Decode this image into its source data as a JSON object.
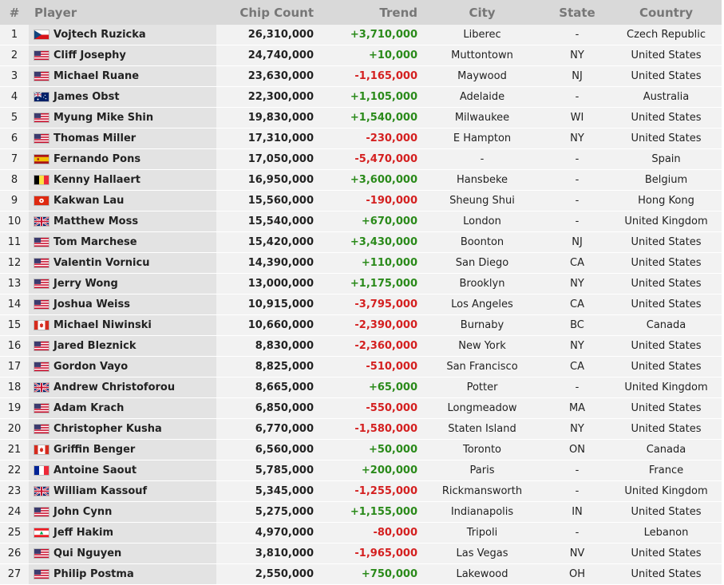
{
  "headers": {
    "num": "#",
    "player": "Player",
    "chips": "Chip Count",
    "trend": "Trend",
    "city": "City",
    "state": "State",
    "country": "Country"
  },
  "rows": [
    {
      "num": "1",
      "name": "Vojtech Ruzicka",
      "flag": "cz",
      "chips": "26,310,000",
      "trend": "+3,710,000",
      "dir": "up",
      "city": "Liberec",
      "state": "-",
      "country": "Czech Republic"
    },
    {
      "num": "2",
      "name": "Cliff Josephy",
      "flag": "us",
      "chips": "24,740,000",
      "trend": "+10,000",
      "dir": "up",
      "city": "Muttontown",
      "state": "NY",
      "country": "United States"
    },
    {
      "num": "3",
      "name": "Michael Ruane",
      "flag": "us",
      "chips": "23,630,000",
      "trend": "-1,165,000",
      "dir": "down",
      "city": "Maywood",
      "state": "NJ",
      "country": "United States"
    },
    {
      "num": "4",
      "name": "James Obst",
      "flag": "au",
      "chips": "22,300,000",
      "trend": "+1,105,000",
      "dir": "up",
      "city": "Adelaide",
      "state": "-",
      "country": "Australia"
    },
    {
      "num": "5",
      "name": "Myung Mike Shin",
      "flag": "us",
      "chips": "19,830,000",
      "trend": "+1,540,000",
      "dir": "up",
      "city": "Milwaukee",
      "state": "WI",
      "country": "United States"
    },
    {
      "num": "6",
      "name": "Thomas Miller",
      "flag": "us",
      "chips": "17,310,000",
      "trend": "-230,000",
      "dir": "down",
      "city": "E Hampton",
      "state": "NY",
      "country": "United States"
    },
    {
      "num": "7",
      "name": "Fernando Pons",
      "flag": "es",
      "chips": "17,050,000",
      "trend": "-5,470,000",
      "dir": "down",
      "city": "-",
      "state": "-",
      "country": "Spain"
    },
    {
      "num": "8",
      "name": "Kenny Hallaert",
      "flag": "be",
      "chips": "16,950,000",
      "trend": "+3,600,000",
      "dir": "up",
      "city": "Hansbeke",
      "state": "-",
      "country": "Belgium"
    },
    {
      "num": "9",
      "name": "Kakwan Lau",
      "flag": "hk",
      "chips": "15,560,000",
      "trend": "-190,000",
      "dir": "down",
      "city": "Sheung Shui",
      "state": "-",
      "country": "Hong Kong"
    },
    {
      "num": "10",
      "name": "Matthew Moss",
      "flag": "gb",
      "chips": "15,540,000",
      "trend": "+670,000",
      "dir": "up",
      "city": "London",
      "state": "-",
      "country": "United Kingdom"
    },
    {
      "num": "11",
      "name": "Tom Marchese",
      "flag": "us",
      "chips": "15,420,000",
      "trend": "+3,430,000",
      "dir": "up",
      "city": "Boonton",
      "state": "NJ",
      "country": "United States"
    },
    {
      "num": "12",
      "name": "Valentin Vornicu",
      "flag": "us",
      "chips": "14,390,000",
      "trend": "+110,000",
      "dir": "up",
      "city": "San Diego",
      "state": "CA",
      "country": "United States"
    },
    {
      "num": "13",
      "name": "Jerry Wong",
      "flag": "us",
      "chips": "13,000,000",
      "trend": "+1,175,000",
      "dir": "up",
      "city": "Brooklyn",
      "state": "NY",
      "country": "United States"
    },
    {
      "num": "14",
      "name": "Joshua Weiss",
      "flag": "us",
      "chips": "10,915,000",
      "trend": "-3,795,000",
      "dir": "down",
      "city": "Los Angeles",
      "state": "CA",
      "country": "United States"
    },
    {
      "num": "15",
      "name": "Michael Niwinski",
      "flag": "ca",
      "chips": "10,660,000",
      "trend": "-2,390,000",
      "dir": "down",
      "city": "Burnaby",
      "state": "BC",
      "country": "Canada"
    },
    {
      "num": "16",
      "name": "Jared Bleznick",
      "flag": "us",
      "chips": "8,830,000",
      "trend": "-2,360,000",
      "dir": "down",
      "city": "New York",
      "state": "NY",
      "country": "United States"
    },
    {
      "num": "17",
      "name": "Gordon Vayo",
      "flag": "us",
      "chips": "8,825,000",
      "trend": "-510,000",
      "dir": "down",
      "city": "San Francisco",
      "state": "CA",
      "country": "United States"
    },
    {
      "num": "18",
      "name": "Andrew Christoforou",
      "flag": "gb",
      "chips": "8,665,000",
      "trend": "+65,000",
      "dir": "up",
      "city": "Potter",
      "state": "-",
      "country": "United Kingdom"
    },
    {
      "num": "19",
      "name": "Adam Krach",
      "flag": "us",
      "chips": "6,850,000",
      "trend": "-550,000",
      "dir": "down",
      "city": "Longmeadow",
      "state": "MA",
      "country": "United States"
    },
    {
      "num": "20",
      "name": "Christopher Kusha",
      "flag": "us",
      "chips": "6,770,000",
      "trend": "-1,580,000",
      "dir": "down",
      "city": "Staten Island",
      "state": "NY",
      "country": "United States"
    },
    {
      "num": "21",
      "name": "Griffin Benger",
      "flag": "ca",
      "chips": "6,560,000",
      "trend": "+50,000",
      "dir": "up",
      "city": "Toronto",
      "state": "ON",
      "country": "Canada"
    },
    {
      "num": "22",
      "name": "Antoine Saout",
      "flag": "fr",
      "chips": "5,785,000",
      "trend": "+200,000",
      "dir": "up",
      "city": "Paris",
      "state": "-",
      "country": "France"
    },
    {
      "num": "23",
      "name": "William Kassouf",
      "flag": "gb",
      "chips": "5,345,000",
      "trend": "-1,255,000",
      "dir": "down",
      "city": "Rickmansworth",
      "state": "-",
      "country": "United Kingdom"
    },
    {
      "num": "24",
      "name": "John Cynn",
      "flag": "us",
      "chips": "5,275,000",
      "trend": "+1,155,000",
      "dir": "up",
      "city": "Indianapolis",
      "state": "IN",
      "country": "United States"
    },
    {
      "num": "25",
      "name": "Jeff Hakim",
      "flag": "lb",
      "chips": "4,970,000",
      "trend": "-80,000",
      "dir": "down",
      "city": "Tripoli",
      "state": "-",
      "country": "Lebanon"
    },
    {
      "num": "26",
      "name": "Qui Nguyen",
      "flag": "us",
      "chips": "3,810,000",
      "trend": "-1,965,000",
      "dir": "down",
      "city": "Las Vegas",
      "state": "NV",
      "country": "United States"
    },
    {
      "num": "27",
      "name": "Philip Postma",
      "flag": "us",
      "chips": "2,550,000",
      "trend": "+750,000",
      "dir": "up",
      "city": "Lakewood",
      "state": "OH",
      "country": "United States"
    }
  ]
}
